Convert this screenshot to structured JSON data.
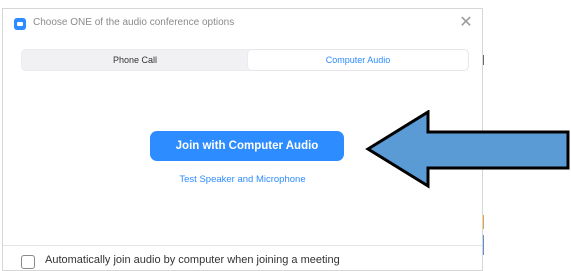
{
  "dialog": {
    "title": "Choose ONE of the audio conference options",
    "close_icon": "close-icon",
    "app_icon": "zoom-logo-icon"
  },
  "tabs": [
    {
      "label": "Phone Call",
      "selected": false
    },
    {
      "label": "Computer Audio",
      "selected": true
    }
  ],
  "main": {
    "join_button_label": "Join with Computer Audio",
    "test_link_label": "Test Speaker and Microphone"
  },
  "footer": {
    "auto_join_label": "Automatically join audio by computer when joining a meeting",
    "auto_join_checked": false
  },
  "annotation": {
    "arrow": "left-pointing-arrow",
    "arrow_color": "#5b9bd5"
  },
  "colors": {
    "accent": "#2d8cff",
    "tab_bar_bg": "#f1f1f4",
    "title_text": "#8a8a8a"
  }
}
